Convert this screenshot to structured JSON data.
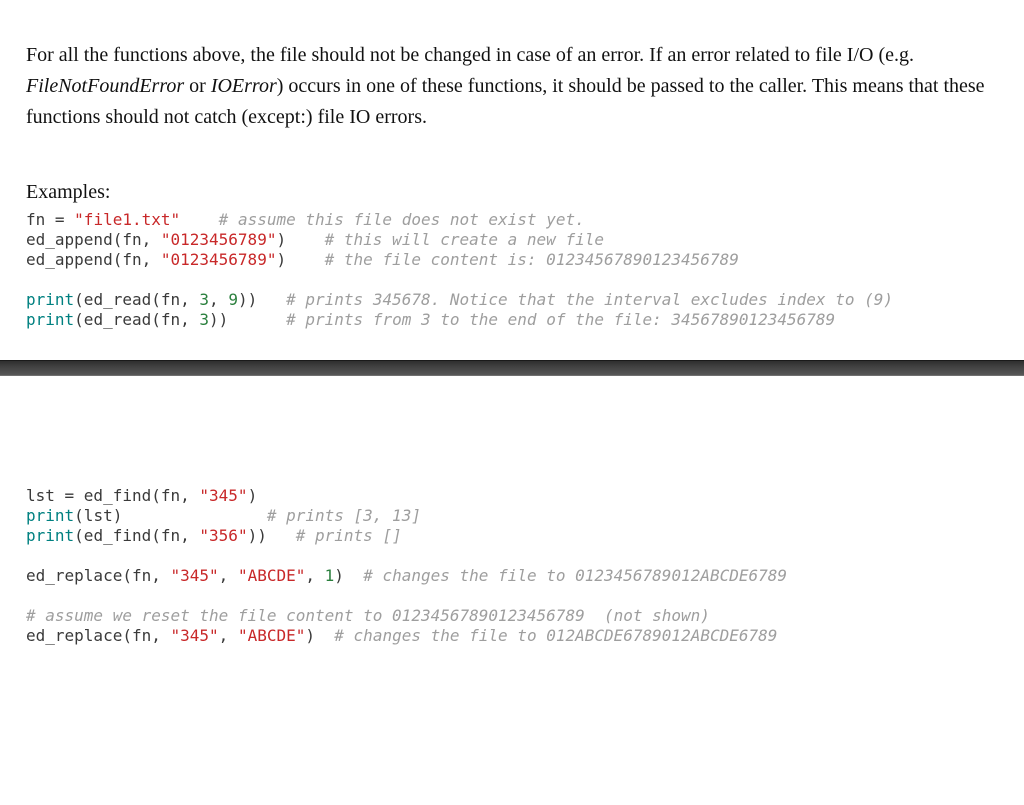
{
  "prose": {
    "line1a": "For all the functions above, the file should not be changed in case of an error. If an error related to file I/O (e.g. ",
    "err1": "FileNotFoundError",
    "line1b": " or ",
    "err2": "IOError",
    "line1c": ") occurs in one of these functions, it should be passed to the caller. This means that these functions should not catch (except:) file IO errors."
  },
  "examples_heading": "Examples:",
  "code1": {
    "l1_a": "fn = ",
    "l1_str": "\"file1.txt\"",
    "l1_pad": "    ",
    "l1_cmt": "# assume this file does not exist yet.",
    "l2_a": "ed_append(fn, ",
    "l2_str": "\"0123456789\"",
    "l2_b": ")    ",
    "l2_cmt": "# this will create a new file",
    "l3_a": "ed_append(fn, ",
    "l3_str": "\"0123456789\"",
    "l3_b": ")    ",
    "l3_cmt": "# the file content is: 01234567890123456789",
    "blank": "",
    "l5_fn": "print",
    "l5_a": "(ed_read(fn, ",
    "l5_n1": "3",
    "l5_b": ", ",
    "l5_n2": "9",
    "l5_c": "))   ",
    "l5_cmt": "# prints 345678. Notice that the interval excludes index to (9)",
    "l6_fn": "print",
    "l6_a": "(ed_read(fn, ",
    "l6_n1": "3",
    "l6_b": "))      ",
    "l6_cmt": "# prints from 3 to the end of the file: 34567890123456789"
  },
  "code2": {
    "l1_a": "lst = ed_find(fn, ",
    "l1_str": "\"345\"",
    "l1_b": ")",
    "l2_fn": "print",
    "l2_a": "(lst)               ",
    "l2_cmt": "# prints [3, 13]",
    "l3_fn": "print",
    "l3_a": "(ed_find(fn, ",
    "l3_str": "\"356\"",
    "l3_b": "))   ",
    "l3_cmt": "# prints []",
    "blank": "",
    "l5_a": "ed_replace(fn, ",
    "l5_s1": "\"345\"",
    "l5_b": ", ",
    "l5_s2": "\"ABCDE\"",
    "l5_c": ", ",
    "l5_n": "1",
    "l5_d": ")  ",
    "l5_cmt": "# changes the file to 0123456789012ABCDE6789",
    "l7_cmt": "# assume we reset the file content to 01234567890123456789  (not shown)",
    "l8_a": "ed_replace(fn, ",
    "l8_s1": "\"345\"",
    "l8_b": ", ",
    "l8_s2": "\"ABCDE\"",
    "l8_c": ")  ",
    "l8_cmt": "# changes the file to 012ABCDE6789012ABCDE6789"
  }
}
